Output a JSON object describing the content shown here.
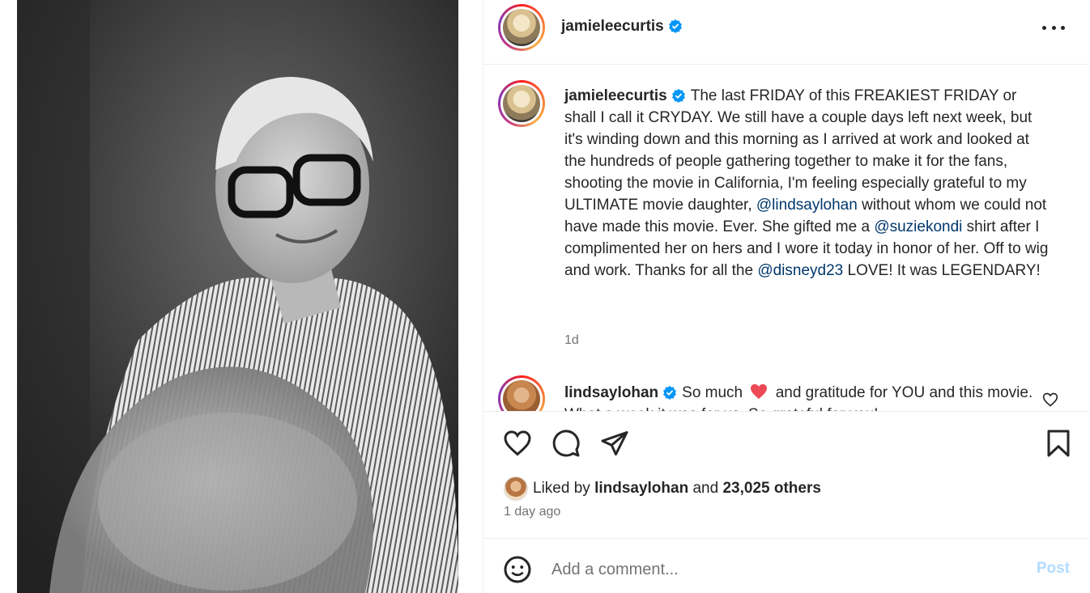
{
  "post": {
    "author": "jamieleecurtis",
    "verified": true,
    "caption_parts": [
      "The last FRIDAY of this FREAKIEST FRIDAY or shall I call it CRYDAY. We still have a couple days left next week, but it's winding down and this morning as I arrived at work and looked at the hundreds of people gathering together to make it for the fans, shooting the movie in California, I'm feeling especially grateful to my ULTIMATE movie daughter, ",
      "@lindsaylohan",
      " without whom we could not have made this movie. Ever. She gifted me a ",
      "@suziekondi",
      " shirt after I complimented her on hers and I wore it today in honor of her. Off to wig and work. Thanks for all the ",
      "@disneyd23",
      " LOVE! It was LEGENDARY!"
    ],
    "caption_time": "1d"
  },
  "comment": {
    "author": "lindsaylohan",
    "text_before_heart": "So much",
    "text_after_heart": "and gratitude for YOU and this movie. What a week it was for us. So grateful for you!"
  },
  "likes": {
    "prefix": "Liked by",
    "user": "lindsaylohan",
    "connector": "and",
    "others": "23,025 others"
  },
  "post_time": "1 day ago",
  "comment_box": {
    "placeholder": "Add a comment...",
    "post_label": "Post"
  },
  "icons": {
    "more": "more-options-icon",
    "verified": "verified-badge-icon",
    "like": "heart-icon",
    "comment": "comment-icon",
    "share": "paper-plane-icon",
    "save": "bookmark-icon",
    "emoji": "emoji-icon"
  },
  "colors": {
    "mention": "#00376b",
    "verified": "#0095f6",
    "post_button_disabled": "#b3dbff",
    "heart_emoji": "#ed4956"
  }
}
